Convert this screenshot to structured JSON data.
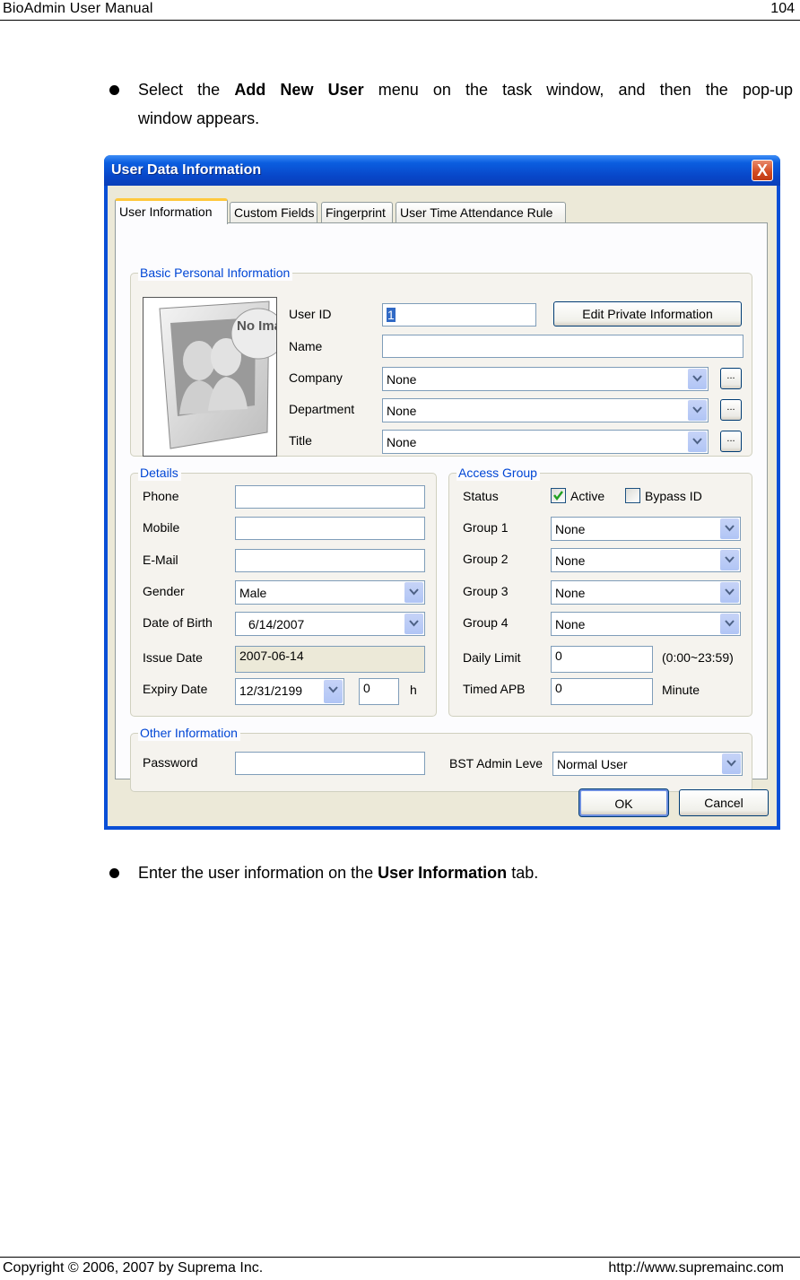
{
  "header": {
    "title": "BioAdmin  User  Manual",
    "page_number": "104"
  },
  "footer": {
    "copyright": "Copyright © 2006, 2007 by Suprema Inc.",
    "url": "http://www.supremainc.com"
  },
  "bullets": [
    {
      "pre": "Select  the ",
      "bold": "Add  New  User",
      "post": " menu  on  the  task  window,  and  then  the  pop-up",
      "line2": "window appears."
    },
    {
      "pre": "Enter the user information on the ",
      "bold": "User Information",
      "post": " tab."
    }
  ],
  "dialog": {
    "title": "User Data Information",
    "close_label": "X",
    "tabs": [
      {
        "label": "User Information",
        "active": true
      },
      {
        "label": "Custom Fields",
        "active": false
      },
      {
        "label": "Fingerprint",
        "active": false
      },
      {
        "label": "User Time Attendance Rule",
        "active": false
      }
    ],
    "basic": {
      "legend": "Basic Personal Information",
      "photo_text": "No Image",
      "user_id_label": "User ID",
      "user_id_value": "1",
      "edit_private_label": "Edit Private Information",
      "name_label": "Name",
      "name_value": "",
      "company_label": "Company",
      "company_value": "None",
      "department_label": "Department",
      "department_value": "None",
      "title_label": "Title",
      "title_value": "None",
      "browse_label": "..."
    },
    "details": {
      "legend": "Details",
      "phone_label": "Phone",
      "phone_value": "",
      "mobile_label": "Mobile",
      "mobile_value": "",
      "email_label": "E-Mail",
      "email_value": "",
      "gender_label": "Gender",
      "gender_value": "Male",
      "dob_label": "Date of Birth",
      "dob_value": "6/14/2007",
      "issue_label": "Issue Date",
      "issue_value": "2007-06-14",
      "expiry_label": "Expiry Date",
      "expiry_value": "12/31/2199",
      "expiry_hour_value": "0",
      "hour_unit": "h"
    },
    "access": {
      "legend": "Access Group",
      "status_label": "Status",
      "active_label": "Active",
      "active_checked": true,
      "bypass_label": "Bypass ID",
      "bypass_checked": false,
      "group1_label": "Group 1",
      "group1_value": "None",
      "group2_label": "Group 2",
      "group2_value": "None",
      "group3_label": "Group 3",
      "group3_value": "None",
      "group4_label": "Group 4",
      "group4_value": "None",
      "daily_limit_label": "Daily Limit",
      "daily_limit_value": "0",
      "daily_limit_hint": "(0:00~23:59)",
      "timed_apb_label": "Timed APB",
      "timed_apb_value": "0",
      "timed_apb_unit": "Minute"
    },
    "other": {
      "legend": "Other Information",
      "password_label": "Password",
      "password_value": "",
      "admin_level_label": "BST Admin Leve",
      "admin_level_value": "Normal User"
    },
    "ok_label": "OK",
    "cancel_label": "Cancel"
  }
}
